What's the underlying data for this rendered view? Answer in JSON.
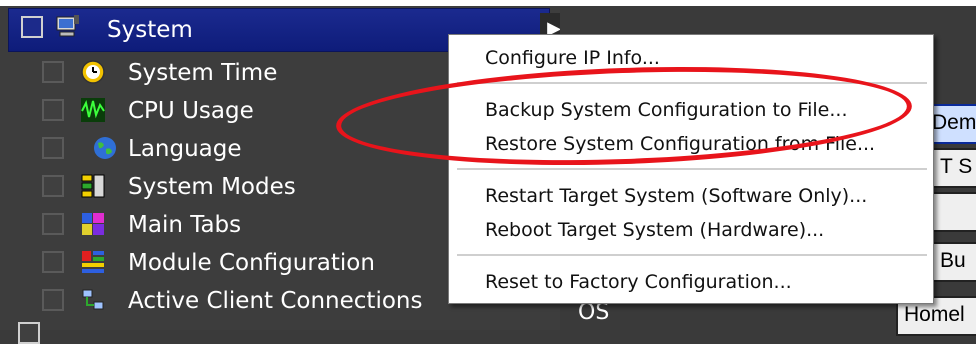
{
  "tree": {
    "header": {
      "label": "System"
    },
    "items": [
      {
        "label": "System Time",
        "icon": "clock-icon"
      },
      {
        "label": "CPU Usage",
        "icon": "waveform-icon"
      },
      {
        "label": "Language",
        "icon": "globe-icon"
      },
      {
        "label": "System Modes",
        "icon": "modes-icon"
      },
      {
        "label": "Main Tabs",
        "icon": "tabs-icon"
      },
      {
        "label": "Module Configuration",
        "icon": "modules-icon"
      },
      {
        "label": "Active Client Connections",
        "icon": "network-icon"
      }
    ]
  },
  "context_menu": {
    "items": [
      "Configure IP Info...",
      "Backup System Configuration to File...",
      "Restore System Configuration from File...",
      "Restart Target System (Software Only)...",
      "Reboot Target System (Hardware)...",
      "Reset to Factory Configuration..."
    ]
  },
  "side_buttons": [
    "Dem",
    "T S",
    "",
    "Bu",
    "Homel"
  ],
  "os_label": "OS",
  "colors": {
    "highlight": "#e8141b",
    "header": "#14237f",
    "tree_bg": "#3d3d3d"
  }
}
